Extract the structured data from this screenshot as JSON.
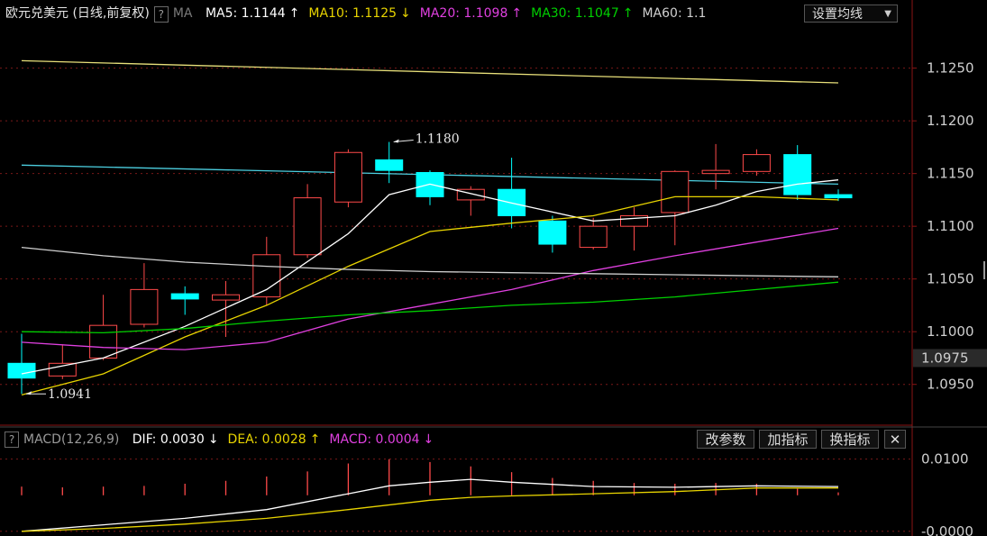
{
  "header": {
    "title": "欧元兑美元 (日线,前复权)",
    "help_icon": "?",
    "ma_label": "MA",
    "ma_items": [
      {
        "label": "MA5: 1.1144",
        "arrow": "↑",
        "color": "#ffffff"
      },
      {
        "label": "MA10: 1.1125",
        "arrow": "↓",
        "color": "#e8d400"
      },
      {
        "label": "MA20: 1.1098",
        "arrow": "↑",
        "color": "#e040e0"
      },
      {
        "label": "MA30: 1.1047",
        "arrow": "↑",
        "color": "#00d000"
      },
      {
        "label": "MA60: 1.1",
        "arrow": "",
        "color": "#d0d0d0"
      }
    ],
    "settings_button": "设置均线"
  },
  "macd_header": {
    "help_icon": "?",
    "label": "MACD(12,26,9)",
    "dif": {
      "label": "DIF: 0.0030",
      "arrow": "↓",
      "color": "#ffffff"
    },
    "dea": {
      "label": "DEA: 0.0028",
      "arrow": "↑",
      "color": "#e8d400"
    },
    "macd": {
      "label": "MACD: 0.0004",
      "arrow": "↓",
      "color": "#e040e0"
    },
    "buttons": [
      "改参数",
      "加指标",
      "换指标"
    ],
    "close_icon": "✕"
  },
  "chart_data": [
    {
      "type": "candlestick",
      "ylim": [
        1.0913,
        1.1289
      ],
      "y_ticks": [
        "1.1250",
        "1.1200",
        "1.1150",
        "1.1100",
        "1.1050",
        "1.1000",
        "1.0950"
      ],
      "current_price": "1.0975",
      "annotations": [
        {
          "text": "1.1180",
          "candle_index": 9,
          "value": 1.118
        },
        {
          "text": "1.0941",
          "candle_index": 0,
          "value": 1.0941
        }
      ],
      "candles": [
        {
          "open": 1.097,
          "high": 1.0998,
          "low": 1.0941,
          "close": 1.0956
        },
        {
          "open": 1.0958,
          "high": 1.0988,
          "low": 1.0955,
          "close": 1.097
        },
        {
          "open": 1.0975,
          "high": 1.1035,
          "low": 1.0973,
          "close": 1.1006
        },
        {
          "open": 1.1007,
          "high": 1.1065,
          "low": 1.1004,
          "close": 1.104
        },
        {
          "open": 1.1036,
          "high": 1.1043,
          "low": 1.1016,
          "close": 1.1031
        },
        {
          "open": 1.103,
          "high": 1.1048,
          "low": 1.0995,
          "close": 1.1035
        },
        {
          "open": 1.1033,
          "high": 1.109,
          "low": 1.1025,
          "close": 1.1073
        },
        {
          "open": 1.1073,
          "high": 1.114,
          "low": 1.107,
          "close": 1.1127
        },
        {
          "open": 1.1123,
          "high": 1.1173,
          "low": 1.1118,
          "close": 1.117
        },
        {
          "open": 1.1163,
          "high": 1.118,
          "low": 1.1141,
          "close": 1.1153
        },
        {
          "open": 1.1151,
          "high": 1.1153,
          "low": 1.112,
          "close": 1.1128
        },
        {
          "open": 1.1125,
          "high": 1.1138,
          "low": 1.111,
          "close": 1.1135
        },
        {
          "open": 1.1135,
          "high": 1.1165,
          "low": 1.1098,
          "close": 1.111
        },
        {
          "open": 1.1105,
          "high": 1.111,
          "low": 1.1075,
          "close": 1.1083
        },
        {
          "open": 1.108,
          "high": 1.1108,
          "low": 1.1078,
          "close": 1.11
        },
        {
          "open": 1.11,
          "high": 1.1118,
          "low": 1.1077,
          "close": 1.111
        },
        {
          "open": 1.1113,
          "high": 1.1153,
          "low": 1.1082,
          "close": 1.1152
        },
        {
          "open": 1.115,
          "high": 1.1178,
          "low": 1.1135,
          "close": 1.1153
        },
        {
          "open": 1.1152,
          "high": 1.1173,
          "low": 1.1148,
          "close": 1.1168
        },
        {
          "open": 1.1168,
          "high": 1.1177,
          "low": 1.1125,
          "close": 1.113
        },
        {
          "open": 1.113,
          "high": 1.1135,
          "low": 1.1124,
          "close": 1.1127
        }
      ],
      "up_color": "#ff4a4a",
      "down_color": "#00ffff",
      "series": [
        {
          "name": "MA5",
          "color": "#ffffff",
          "x": [
            0,
            2,
            4,
            6,
            8,
            9,
            10,
            12,
            14,
            16,
            17,
            18,
            19,
            20
          ],
          "values": [
            1.096,
            1.0975,
            1.1005,
            1.104,
            1.1093,
            1.113,
            1.114,
            1.1122,
            1.1105,
            1.111,
            1.112,
            1.1133,
            1.114,
            1.1144
          ]
        },
        {
          "name": "MA10",
          "color": "#e8d400",
          "x": [
            0,
            2,
            4,
            6,
            8,
            10,
            12,
            14,
            16,
            18,
            20
          ],
          "values": [
            1.094,
            1.096,
            1.0995,
            1.1025,
            1.1062,
            1.1095,
            1.1103,
            1.111,
            1.1128,
            1.1128,
            1.1125
          ]
        },
        {
          "name": "MA20",
          "color": "#e040e0",
          "x": [
            0,
            2,
            4,
            6,
            8,
            10,
            12,
            14,
            16,
            18,
            20
          ],
          "values": [
            1.099,
            1.0985,
            1.0983,
            1.099,
            1.1012,
            1.1026,
            1.104,
            1.1058,
            1.1072,
            1.1085,
            1.1098
          ]
        },
        {
          "name": "MA30",
          "color": "#00d000",
          "x": [
            0,
            2,
            4,
            6,
            8,
            10,
            12,
            14,
            16,
            18,
            20
          ],
          "values": [
            1.1,
            1.0999,
            1.1003,
            1.101,
            1.1016,
            1.102,
            1.1025,
            1.1028,
            1.1033,
            1.104,
            1.1047
          ]
        },
        {
          "name": "MA60",
          "color": "#d0d0d0",
          "x": [
            0,
            2,
            4,
            6,
            8,
            10,
            12,
            14,
            16,
            18,
            20
          ],
          "values": [
            1.108,
            1.1072,
            1.1066,
            1.1062,
            1.1059,
            1.1057,
            1.1056,
            1.1055,
            1.1054,
            1.1053,
            1.1052
          ]
        },
        {
          "name": "",
          "color": "#e8e07a",
          "x": [
            0,
            20
          ],
          "values": [
            1.1257,
            1.1236
          ]
        },
        {
          "name": "",
          "color": "#4ccfe0",
          "x": [
            0,
            20
          ],
          "values": [
            1.1158,
            1.114
          ]
        }
      ]
    },
    {
      "type": "macd",
      "ylim": [
        -0.0004,
        0.0112
      ],
      "y_ticks": [
        "0.0100",
        "-0.0000"
      ],
      "series": [
        {
          "name": "DIF",
          "color": "#ffffff",
          "x": [
            0,
            2,
            4,
            6,
            8,
            9,
            10,
            11,
            12,
            14,
            16,
            18,
            20
          ],
          "values": [
            0.0,
            0.0009,
            0.0018,
            0.003,
            0.0052,
            0.0063,
            0.0068,
            0.0072,
            0.0068,
            0.0062,
            0.0061,
            0.0063,
            0.0062
          ]
        },
        {
          "name": "DEA",
          "color": "#e8d400",
          "x": [
            0,
            2,
            4,
            6,
            8,
            10,
            11,
            12,
            14,
            16,
            18,
            20
          ],
          "values": [
            0.0,
            0.0004,
            0.001,
            0.0018,
            0.003,
            0.0043,
            0.0047,
            0.0049,
            0.0052,
            0.0055,
            0.006,
            0.006
          ]
        },
        {
          "name": "MACD",
          "color": "#ff4a4a",
          "type": "bar",
          "values": [
            0.0012,
            0.0011,
            0.0012,
            0.0013,
            0.0016,
            0.002,
            0.0026,
            0.0033,
            0.0044,
            0.005,
            0.0046,
            0.004,
            0.0032,
            0.0024,
            0.002,
            0.0017,
            0.0016,
            0.0017,
            0.0016,
            0.0009,
            0.0004
          ]
        }
      ]
    }
  ]
}
